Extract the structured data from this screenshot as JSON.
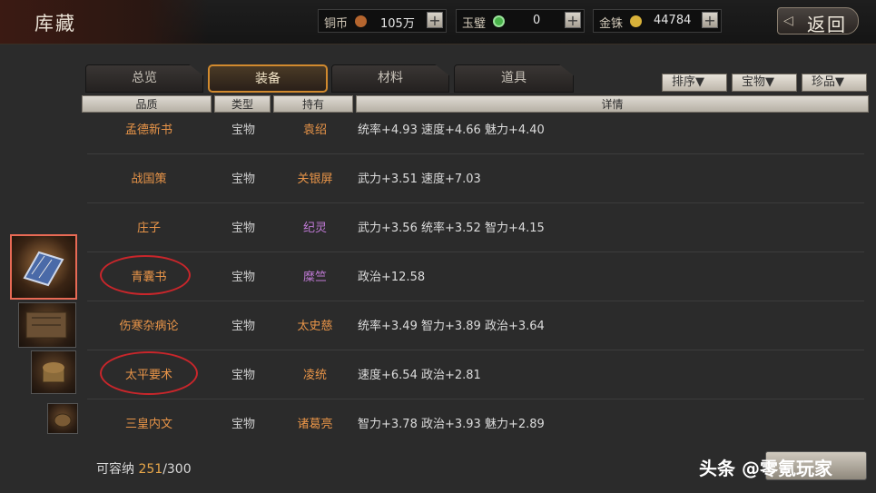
{
  "header": {
    "title": "库藏",
    "back_label": "返回"
  },
  "currencies": [
    {
      "label": "铜币",
      "value": "105万",
      "coin_color": "#b5652e"
    },
    {
      "label": "玉璧",
      "value": "0",
      "coin_color": "#49b34a"
    },
    {
      "label": "金铢",
      "value": "44784",
      "coin_color": "#d9b23a"
    }
  ],
  "tabs": [
    {
      "label": "总览"
    },
    {
      "label": "装备",
      "active": true
    },
    {
      "label": "材料"
    },
    {
      "label": "道具"
    }
  ],
  "sort_buttons": [
    {
      "label": "排序▼"
    },
    {
      "label": "宝物▼"
    },
    {
      "label": "珍品▼"
    }
  ],
  "columns": {
    "quality": "品质",
    "type": "类型",
    "owner": "持有",
    "detail": "详情"
  },
  "rows": [
    {
      "name": "孟德新书",
      "type": "宝物",
      "owner": "袁绍",
      "detail": "统率+4.93  速度+4.66  魅力+4.40"
    },
    {
      "name": "战国策",
      "type": "宝物",
      "owner": "关银屏",
      "detail": "武力+3.51  速度+7.03"
    },
    {
      "name": "庄子",
      "type": "宝物",
      "owner": "纪灵",
      "detail": "武力+3.56  统率+3.52  智力+4.15"
    },
    {
      "name": "青囊书",
      "type": "宝物",
      "owner": "糜竺",
      "detail": "政治+12.58"
    },
    {
      "name": "伤寒杂病论",
      "type": "宝物",
      "owner": "太史慈",
      "detail": "统率+3.49  智力+3.89  政治+3.64"
    },
    {
      "name": "太平要术",
      "type": "宝物",
      "owner": "凌统",
      "detail": "速度+6.54  政治+2.81"
    },
    {
      "name": "三皇内文",
      "type": "宝物",
      "owner": "诸葛亮",
      "detail": "智力+3.78  政治+3.93  魅力+2.89"
    }
  ],
  "owner_colors": {
    "orange": "#e89448",
    "purple": "#c07ad6"
  },
  "capacity": {
    "label": "可容纳",
    "current": "251",
    "total": "/300"
  },
  "watermark": {
    "prefix": "头条 @",
    "name": "零氪玩家"
  }
}
